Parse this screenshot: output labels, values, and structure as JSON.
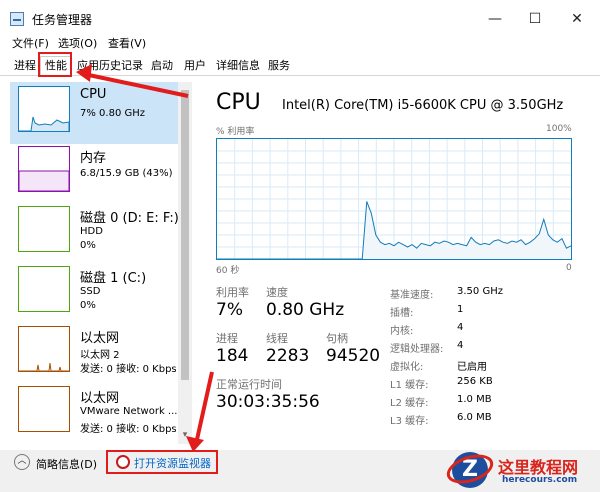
{
  "window": {
    "title": "任务管理器",
    "minimize": "—",
    "maximize": "☐",
    "close": "✕"
  },
  "menu": [
    "文件(F)",
    "选项(O)",
    "查看(V)"
  ],
  "tabs": [
    "进程",
    "性能",
    "应用历史记录",
    "启动",
    "用户",
    "详细信息",
    "服务"
  ],
  "active_tab": "性能",
  "sidebar": [
    {
      "title": "CPU",
      "sub1": "7% 0.80 GHz",
      "sub2": "",
      "color": "#117dbb"
    },
    {
      "title": "内存",
      "sub1": "6.8/15.9 GB (43%)",
      "sub2": "",
      "color": "#8b12ae"
    },
    {
      "title": "磁盘 0 (D: E: F:)",
      "sub1": "HDD",
      "sub2": "0%",
      "color": "#4da60c"
    },
    {
      "title": "磁盘 1 (C:)",
      "sub1": "SSD",
      "sub2": "0%",
      "color": "#4da60c"
    },
    {
      "title": "以太网",
      "sub1": "以太网 2",
      "sub2": "发送: 0 接收: 0 Kbps",
      "color": "#a74f01"
    },
    {
      "title": "以太网",
      "sub1": "VMware Network ...",
      "sub2": "发送: 0 接收: 0 Kbps",
      "color": "#a74f01"
    }
  ],
  "main": {
    "heading": "CPU",
    "model": "Intel(R) Core(TM) i5-6600K CPU @ 3.50GHz",
    "graph_top_left": "% 利用率",
    "graph_top_right": "100%",
    "graph_bottom_left": "60 秒",
    "graph_bottom_right": "0",
    "stats": {
      "util_label": "利用率",
      "util_value": "7%",
      "speed_label": "速度",
      "speed_value": "0.80 GHz",
      "proc_label": "进程",
      "proc_value": "184",
      "thread_label": "线程",
      "thread_value": "2283",
      "handle_label": "句柄",
      "handle_value": "94520",
      "uptime_label": "正常运行时间",
      "uptime_value": "30:03:35:56"
    },
    "details": [
      {
        "label": "基准速度:",
        "value": "3.50 GHz"
      },
      {
        "label": "插槽:",
        "value": "1"
      },
      {
        "label": "内核:",
        "value": "4"
      },
      {
        "label": "逻辑处理器:",
        "value": "4"
      },
      {
        "label": "虚拟化:",
        "value": "已启用"
      },
      {
        "label": "L1 缓存:",
        "value": "256 KB"
      },
      {
        "label": "L2 缓存:",
        "value": "1.0 MB"
      },
      {
        "label": "L3 缓存:",
        "value": "6.0 MB"
      }
    ]
  },
  "footer": {
    "less_details": "简略信息(D)",
    "open_monitor": "打开资源监视器"
  },
  "watermark": {
    "cn": "这里教程网",
    "en": "herecours.com"
  },
  "chart_data": {
    "type": "area",
    "series": [
      {
        "values": [
          0,
          0,
          0,
          0,
          0,
          0,
          0,
          0,
          0,
          0,
          0,
          0,
          0,
          0,
          0,
          0,
          0,
          0,
          0,
          0,
          0,
          0,
          0,
          0,
          0,
          0,
          0,
          0,
          0,
          0,
          0,
          0,
          0,
          48,
          38,
          20,
          14,
          12,
          13,
          11,
          14,
          12,
          10,
          12,
          9,
          13,
          12,
          11,
          14,
          13,
          15,
          14,
          12,
          13,
          12,
          11,
          18,
          14,
          12,
          13,
          12,
          15,
          16,
          14,
          13,
          15,
          14,
          16,
          12,
          14,
          17,
          21,
          33,
          20,
          16,
          14,
          17,
          9,
          11
        ]
      }
    ],
    "ylim": [
      0,
      100
    ]
  }
}
